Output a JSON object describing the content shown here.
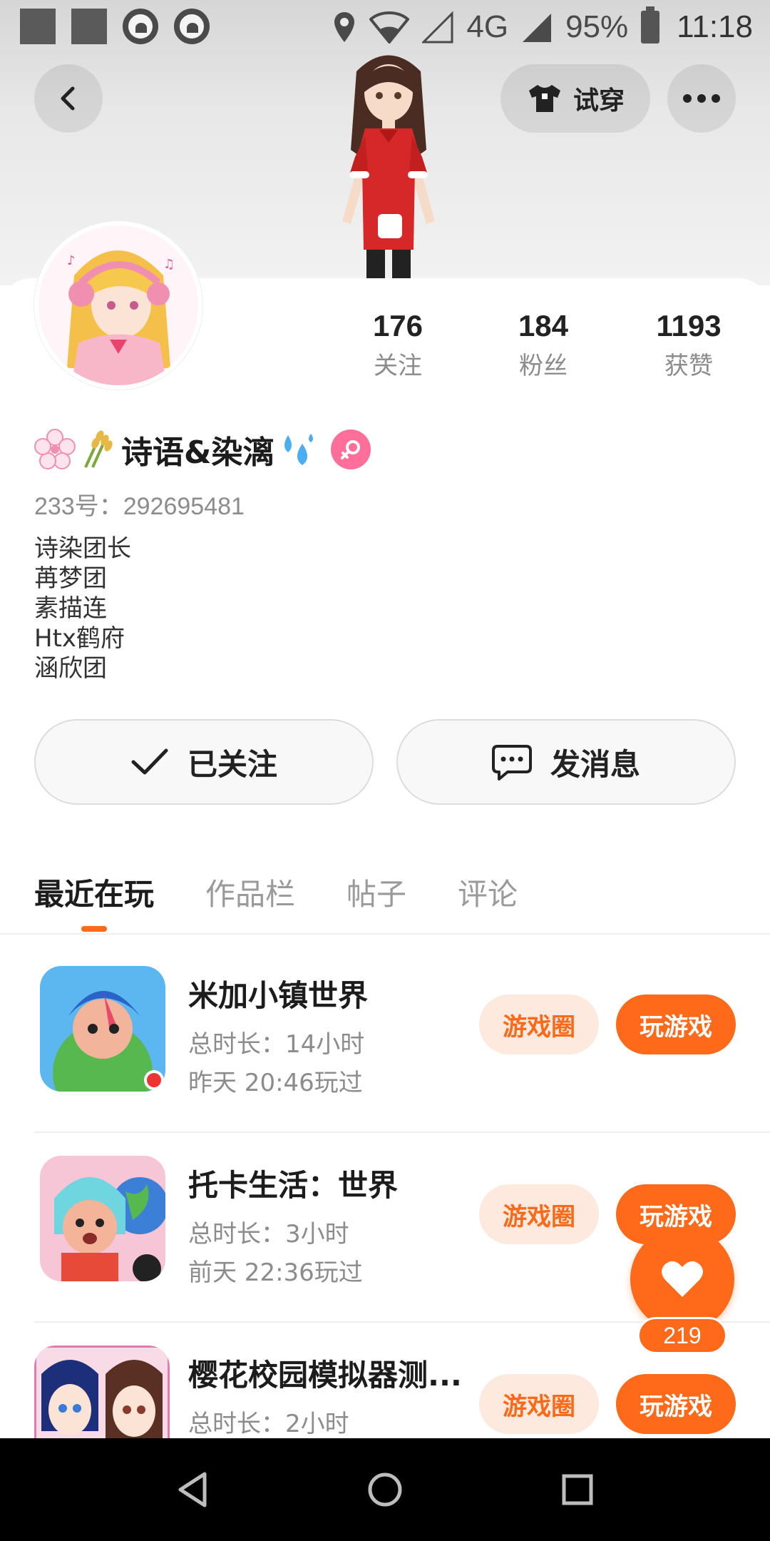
{
  "status_bar": {
    "network": "4G",
    "battery": "95%",
    "time": "11:18"
  },
  "header": {
    "try_on_label": "试穿"
  },
  "profile": {
    "stats": [
      {
        "value": "176",
        "label": "关注"
      },
      {
        "value": "184",
        "label": "粉丝"
      },
      {
        "value": "1193",
        "label": "获赞"
      }
    ],
    "name": "诗语&染漓",
    "uid": "233号：292695481",
    "bio": [
      "诗染团长",
      "苒梦团",
      "素描连",
      "Htx鹤府",
      "涵欣团"
    ]
  },
  "actions": {
    "followed_label": "已关注",
    "message_label": "发消息"
  },
  "tabs": [
    {
      "label": "最近在玩",
      "active": true
    },
    {
      "label": "作品栏",
      "active": false
    },
    {
      "label": "帖子",
      "active": false
    },
    {
      "label": "评论",
      "active": false
    }
  ],
  "games": [
    {
      "title": "米加小镇世界",
      "duration": "总时长：14小时",
      "last_played": "昨天 20:46玩过",
      "circle_label": "游戏圈",
      "play_label": "玩游戏"
    },
    {
      "title": "托卡生活：世界",
      "duration": "总时长：3小时",
      "last_played": "前天 22:36玩过",
      "circle_label": "游戏圈",
      "play_label": "玩游戏"
    },
    {
      "title": "樱花校园模拟器测...",
      "duration": "总时长：2小时",
      "last_played": "",
      "circle_label": "游戏圈",
      "play_label": "玩游戏"
    }
  ],
  "like_fab": {
    "count": "219"
  },
  "colors": {
    "accent": "#ff6a1a",
    "accent_light": "#fde9dd",
    "gender_badge": "#ff6f9a"
  }
}
